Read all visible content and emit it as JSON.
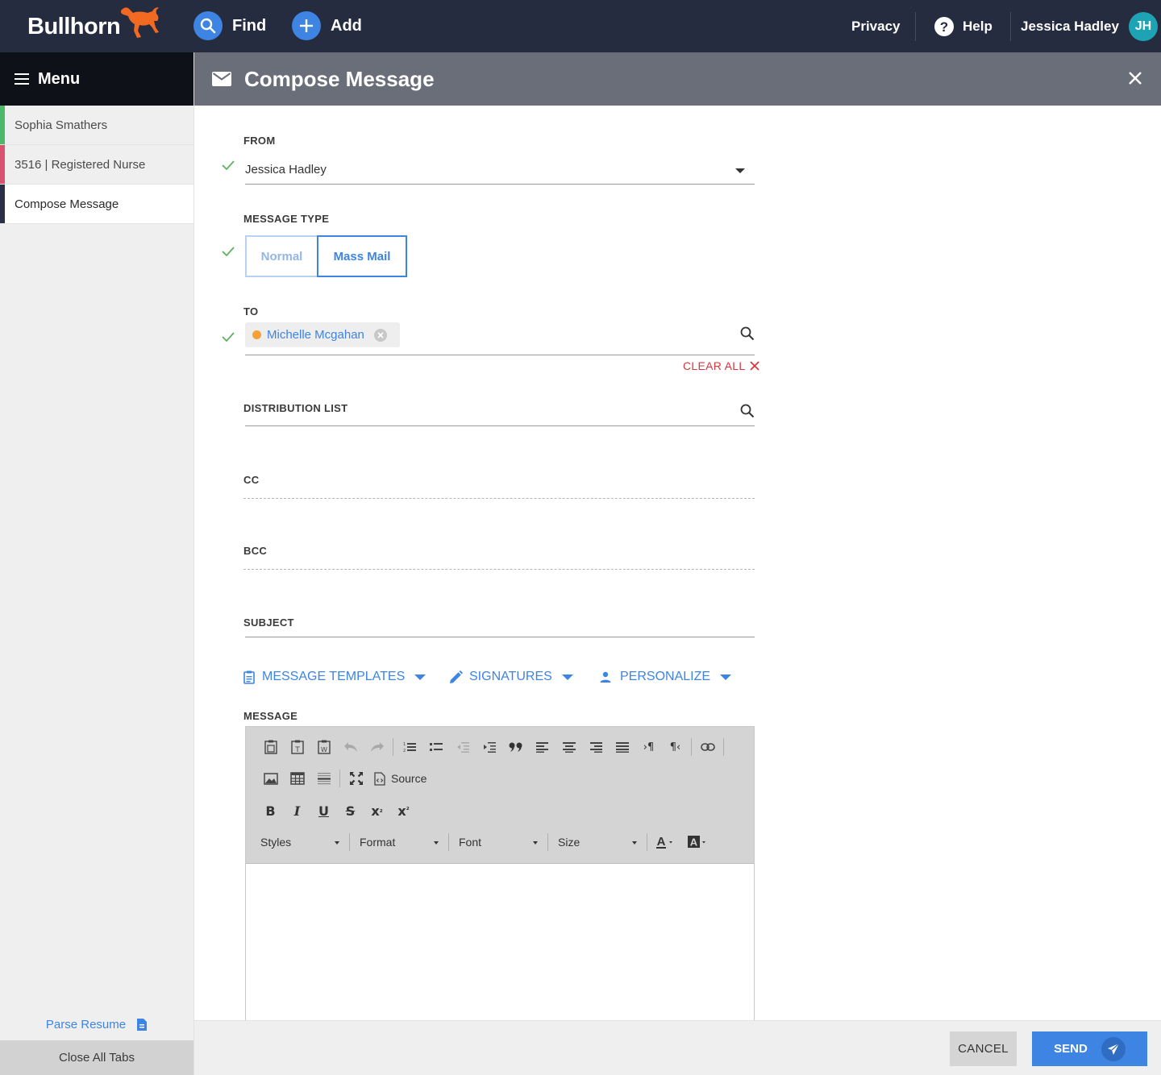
{
  "app": {
    "logo_text": "Bullhorn",
    "find_label": "Find",
    "add_label": "Add",
    "privacy_label": "Privacy",
    "help_label": "Help",
    "user_name": "Jessica Hadley",
    "user_initials": "JH",
    "accent_color": "#3d84e3",
    "brand_color": "#262c3f"
  },
  "sidebar": {
    "menu_label": "Menu",
    "items": [
      {
        "label": "Sophia Smathers",
        "color": "#4cb86a"
      },
      {
        "label": "3516 | Registered Nurse",
        "color": "#d9536f"
      },
      {
        "label": "Compose Message",
        "color": "#2a3046"
      }
    ],
    "parse_resume_label": "Parse Resume",
    "close_all_label": "Close All Tabs"
  },
  "header": {
    "title": "Compose Message"
  },
  "form": {
    "from": {
      "label": "FROM",
      "value": "Jessica Hadley"
    },
    "message_type": {
      "label": "MESSAGE TYPE",
      "options": [
        "Normal",
        "Mass Mail"
      ],
      "selected": "Mass Mail"
    },
    "to": {
      "label": "TO",
      "recipient": "Michelle Mcgahan",
      "clear_all_label": "CLEAR ALL"
    },
    "distribution_list": {
      "label": "DISTRIBUTION LIST"
    },
    "cc": {
      "label": "CC"
    },
    "bcc": {
      "label": "BCC"
    },
    "subject": {
      "label": "SUBJECT"
    },
    "tools": {
      "templates_label": "MESSAGE TEMPLATES",
      "signatures_label": "SIGNATURES",
      "personalize_label": "PERSONALIZE"
    },
    "message": {
      "label": "MESSAGE",
      "source_label": "Source",
      "combos": [
        "Styles",
        "Format",
        "Font",
        "Size"
      ]
    }
  },
  "footer": {
    "cancel_label": "CANCEL",
    "send_label": "SEND"
  }
}
